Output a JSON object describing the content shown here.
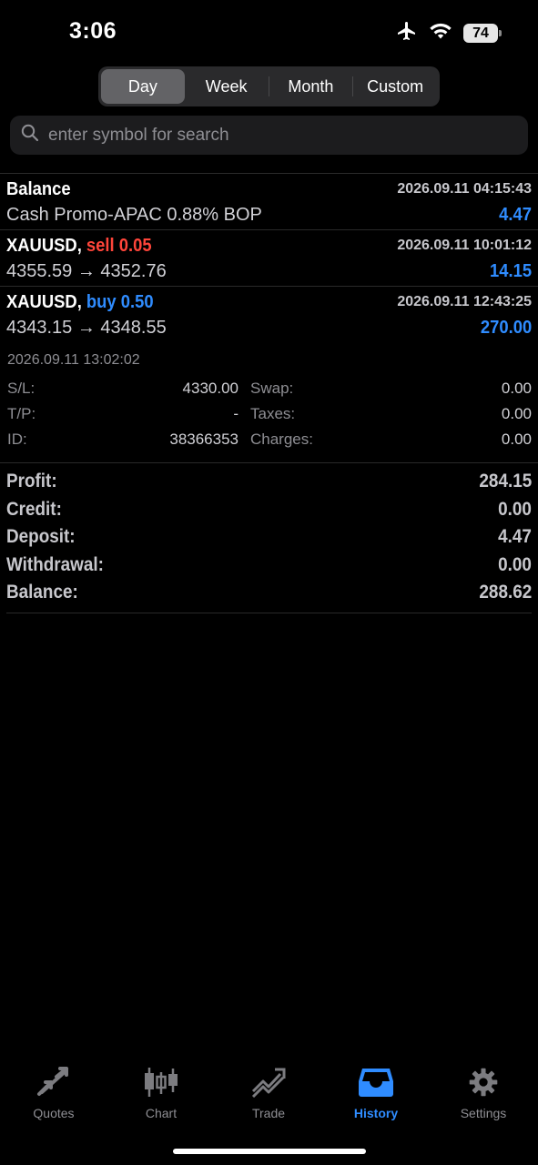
{
  "status": {
    "time": "3:06",
    "battery": "74"
  },
  "periods": {
    "items": [
      "Day",
      "Week",
      "Month",
      "Custom"
    ],
    "selected": "Day"
  },
  "search": {
    "placeholder": "enter symbol for search"
  },
  "records": [
    {
      "title": "Balance",
      "time": "2026.09.11 04:15:43",
      "subtitle": "Cash Promo-APAC 0.88% BOP",
      "value": "4.47"
    },
    {
      "symbol": "XAUUSD,",
      "action": "sell 0.05",
      "time": "2026.09.11 10:01:12",
      "prices": "4355.59 → 4352.76",
      "value": "14.15"
    },
    {
      "symbol": "XAUUSD,",
      "action": "buy 0.50",
      "time": "2026.09.11 12:43:25",
      "prices": "4343.15 → 4348.55",
      "value": "270.00",
      "close_time": "2026.09.11 13:02:02",
      "sl_label": "S/L:",
      "sl_value": "4330.00",
      "tp_label": "T/P:",
      "tp_value": "-",
      "id_label": "ID:",
      "id_value": "38366353",
      "swap_label": "Swap:",
      "swap_value": "0.00",
      "taxes_label": "Taxes:",
      "taxes_value": "0.00",
      "charges_label": "Charges:",
      "charges_value": "0.00"
    }
  ],
  "summary": [
    {
      "label": "Profit:",
      "value": "284.15"
    },
    {
      "label": "Credit:",
      "value": "0.00"
    },
    {
      "label": "Deposit:",
      "value": "4.47"
    },
    {
      "label": "Withdrawal:",
      "value": "0.00"
    },
    {
      "label": "Balance:",
      "value": "288.62"
    }
  ],
  "tabs": [
    {
      "label": "Quotes",
      "icon": "quotes-icon"
    },
    {
      "label": "Chart",
      "icon": "chart-candles-icon"
    },
    {
      "label": "Trade",
      "icon": "trade-icon"
    },
    {
      "label": "History",
      "icon": "history-tray-icon",
      "active": true
    },
    {
      "label": "Settings",
      "icon": "gear-icon"
    }
  ],
  "colors": {
    "accent": "#2f8cff",
    "sell": "#ff453a",
    "background": "#000000"
  }
}
